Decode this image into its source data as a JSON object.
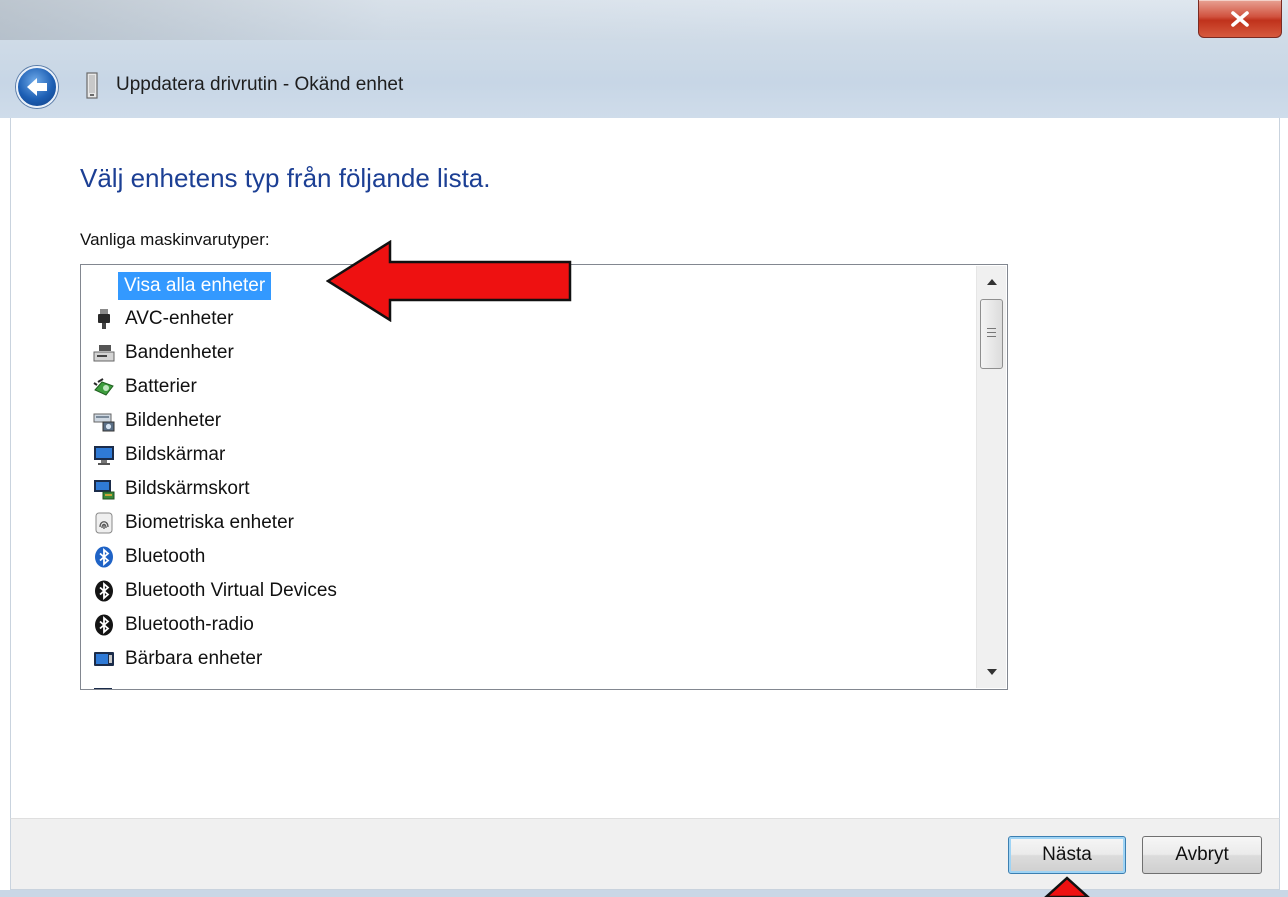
{
  "window": {
    "title": "Uppdatera drivrutin - Okänd enhet",
    "close_symbol": "x"
  },
  "main": {
    "heading": "Välj enhetens typ från följande lista.",
    "list_label": "Vanliga maskinvarutyper:",
    "items": [
      {
        "label": "Visa alla enheter",
        "icon": "none",
        "selected": true
      },
      {
        "label": "AVC-enheter",
        "icon": "usb-plug-icon"
      },
      {
        "label": "Bandenheter",
        "icon": "tape-drive-icon"
      },
      {
        "label": "Batterier",
        "icon": "battery-icon"
      },
      {
        "label": "Bildenheter",
        "icon": "scanner-camera-icon"
      },
      {
        "label": "Bildskärmar",
        "icon": "monitor-icon"
      },
      {
        "label": "Bildskärmskort",
        "icon": "display-adapter-icon"
      },
      {
        "label": "Biometriska enheter",
        "icon": "fingerprint-icon"
      },
      {
        "label": "Bluetooth",
        "icon": "bluetooth-icon"
      },
      {
        "label": "Bluetooth Virtual Devices",
        "icon": "bluetooth-icon"
      },
      {
        "label": "Bluetooth-radio",
        "icon": "bluetooth-icon"
      },
      {
        "label": "Bärbara enheter",
        "icon": "portable-device-icon"
      }
    ]
  },
  "footer": {
    "next_label": "Nästa",
    "cancel_label": "Avbryt"
  },
  "colors": {
    "heading": "#1c3f94",
    "selection": "#3399ff",
    "annotation_arrow": "#ee1111"
  }
}
